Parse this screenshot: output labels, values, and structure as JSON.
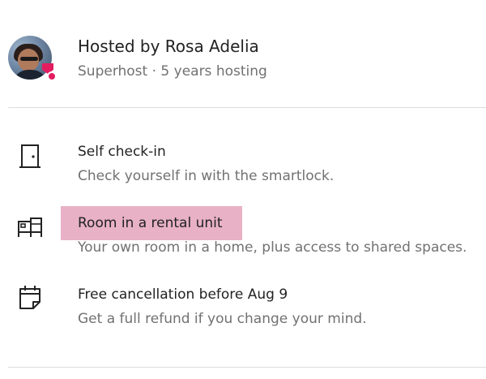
{
  "host": {
    "name": "Hosted by Rosa Adelia",
    "subtitle": "Superhost · 5 years hosting",
    "avatar_alt": "Rosa Adelia"
  },
  "features": [
    {
      "icon": "door-icon",
      "title": "Self check-in",
      "description": "Check yourself in with the smartlock."
    },
    {
      "icon": "room-furniture-icon",
      "title": "Room in a rental unit",
      "description": "Your own room in a home, plus access to shared spaces.",
      "highlighted": true
    },
    {
      "icon": "calendar-icon",
      "title": "Free cancellation before Aug 9",
      "description": "Get a full refund if you change your mind."
    }
  ],
  "colors": {
    "text_primary": "#222222",
    "text_secondary": "#717171",
    "divider": "#dddddd",
    "superhost_badge": "#e31c5f",
    "highlight": "#e8b1c5"
  }
}
